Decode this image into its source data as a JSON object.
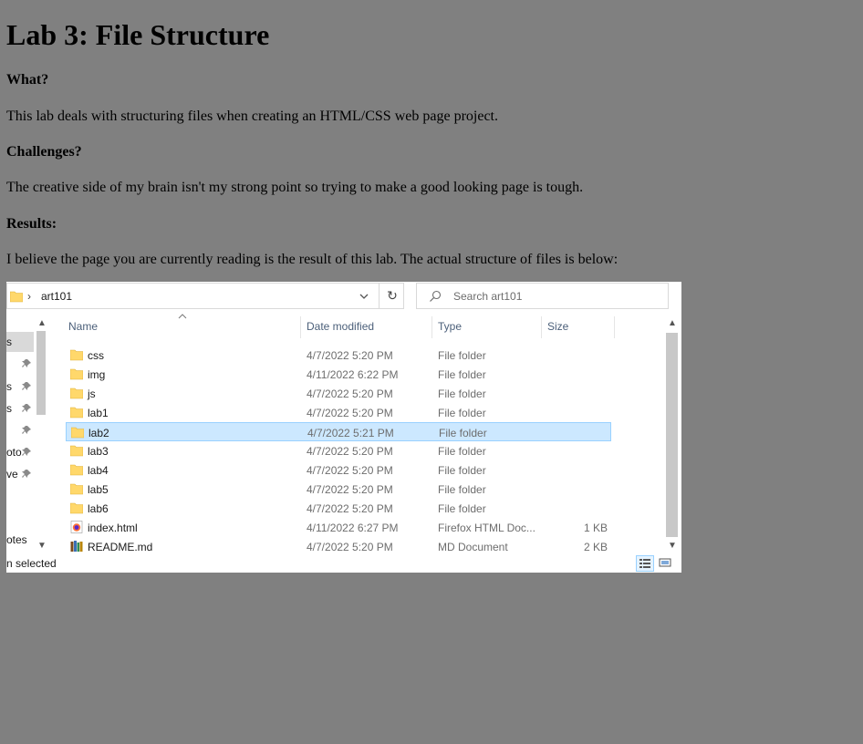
{
  "page": {
    "title": "Lab 3: File Structure",
    "what_heading": "What?",
    "what_text": "This lab deals with structuring files when creating an HTML/CSS web page project.",
    "challenges_heading": "Challenges?",
    "challenges_text": "The creative side of my brain isn't my strong point so trying to make a good looking page is tough.",
    "results_heading": "Results:",
    "results_text": "I believe the page you are currently reading is the result of this lab. The actual structure of files is below:"
  },
  "explorer": {
    "address": {
      "sep": "›",
      "path": "art101",
      "dropdown_icon": "chevron-down-icon",
      "refresh_icon": "refresh-icon"
    },
    "search": {
      "placeholder": "Search art101",
      "icon": "search-icon"
    },
    "columns": {
      "name": "Name",
      "date": "Date modified",
      "type": "Type",
      "size": "Size"
    },
    "nav_fragments": [
      "s",
      "s",
      "s",
      "oto",
      "ve",
      "otes"
    ],
    "files": [
      {
        "name": "css",
        "date": "4/7/2022 5:20 PM",
        "type": "File folder",
        "size": "",
        "icon": "folder-icon",
        "selected": false
      },
      {
        "name": "img",
        "date": "4/11/2022 6:22 PM",
        "type": "File folder",
        "size": "",
        "icon": "folder-icon",
        "selected": false
      },
      {
        "name": "js",
        "date": "4/7/2022 5:20 PM",
        "type": "File folder",
        "size": "",
        "icon": "folder-icon",
        "selected": false
      },
      {
        "name": "lab1",
        "date": "4/7/2022 5:20 PM",
        "type": "File folder",
        "size": "",
        "icon": "folder-icon",
        "selected": false
      },
      {
        "name": "lab2",
        "date": "4/7/2022 5:21 PM",
        "type": "File folder",
        "size": "",
        "icon": "folder-icon",
        "selected": true
      },
      {
        "name": "lab3",
        "date": "4/7/2022 5:20 PM",
        "type": "File folder",
        "size": "",
        "icon": "folder-icon",
        "selected": false
      },
      {
        "name": "lab4",
        "date": "4/7/2022 5:20 PM",
        "type": "File folder",
        "size": "",
        "icon": "folder-icon",
        "selected": false
      },
      {
        "name": "lab5",
        "date": "4/7/2022 5:20 PM",
        "type": "File folder",
        "size": "",
        "icon": "folder-icon",
        "selected": false
      },
      {
        "name": "lab6",
        "date": "4/7/2022 5:20 PM",
        "type": "File folder",
        "size": "",
        "icon": "folder-icon",
        "selected": false
      },
      {
        "name": "index.html",
        "date": "4/11/2022 6:27 PM",
        "type": "Firefox HTML Doc...",
        "size": "1 KB",
        "icon": "firefox-html-icon",
        "selected": false
      },
      {
        "name": "README.md",
        "date": "4/7/2022 5:20 PM",
        "type": "MD Document",
        "size": "2 KB",
        "icon": "books-icon",
        "selected": false
      }
    ],
    "status_text": "n selected"
  },
  "colors": {
    "page_background": "#808080",
    "selection_fill": "#cce8ff",
    "selection_border": "#99d1ff",
    "folder_yellow": "#ffd86b"
  }
}
